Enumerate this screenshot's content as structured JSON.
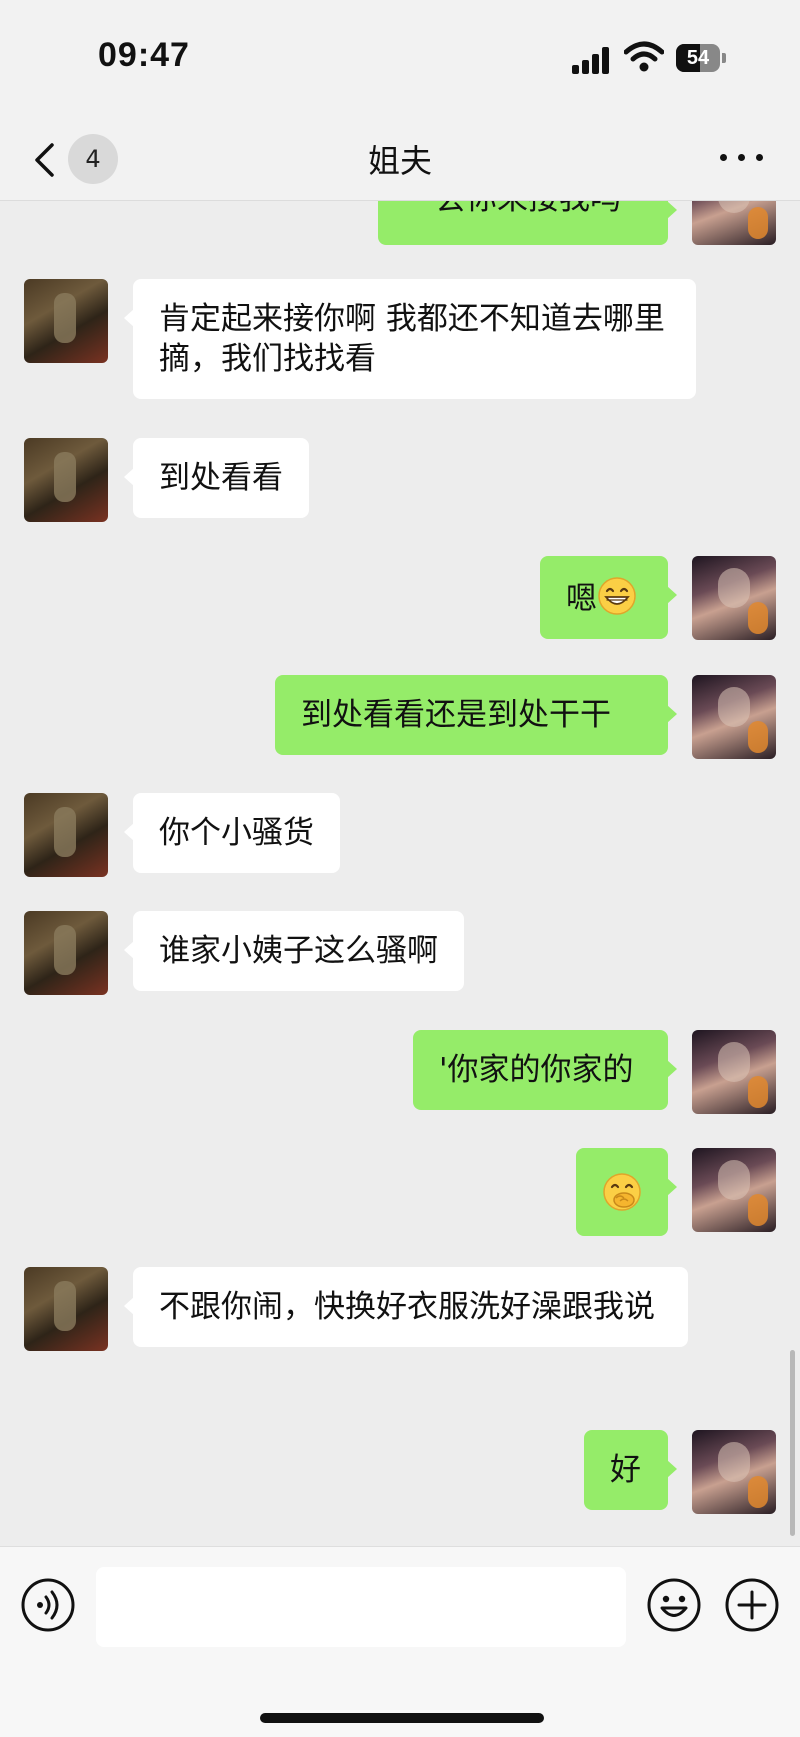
{
  "status_bar": {
    "time": "09:47",
    "battery_level": "54",
    "icons": [
      "signal-icon",
      "wifi-icon",
      "battery-icon"
    ]
  },
  "nav": {
    "back_icon": "chevron-left-icon",
    "unread_count": "4",
    "title": "姐夫",
    "more_icon": "more-dots-icon"
  },
  "messages": [
    {
      "side": "right",
      "text": "一会你来接我吗"
    },
    {
      "side": "left",
      "text": "肯定起来接你啊 我都还不知道去哪里摘，我们找找看"
    },
    {
      "side": "left",
      "text": "到处看看"
    },
    {
      "side": "right",
      "text": "嗯",
      "emoji": "grinning-face-icon"
    },
    {
      "side": "right",
      "text": "到处看看还是到处干干"
    },
    {
      "side": "left",
      "text": "你个小骚货"
    },
    {
      "side": "left",
      "text": "谁家小姨子这么骚啊"
    },
    {
      "side": "right",
      "text": "'你家的你家的"
    },
    {
      "side": "right",
      "text": "",
      "emoji": "hand-over-mouth-icon"
    },
    {
      "side": "left",
      "text": "不跟你闹，快换好衣服洗好澡跟我说"
    },
    {
      "side": "right",
      "text": "好"
    }
  ],
  "input_bar": {
    "voice_icon": "voice-icon",
    "input_value": "",
    "emoji_icon": "smiley-icon",
    "plus_icon": "plus-icon"
  },
  "colors": {
    "background": "#ededed",
    "bubble_sent": "#95ec69",
    "bubble_received": "#ffffff"
  }
}
